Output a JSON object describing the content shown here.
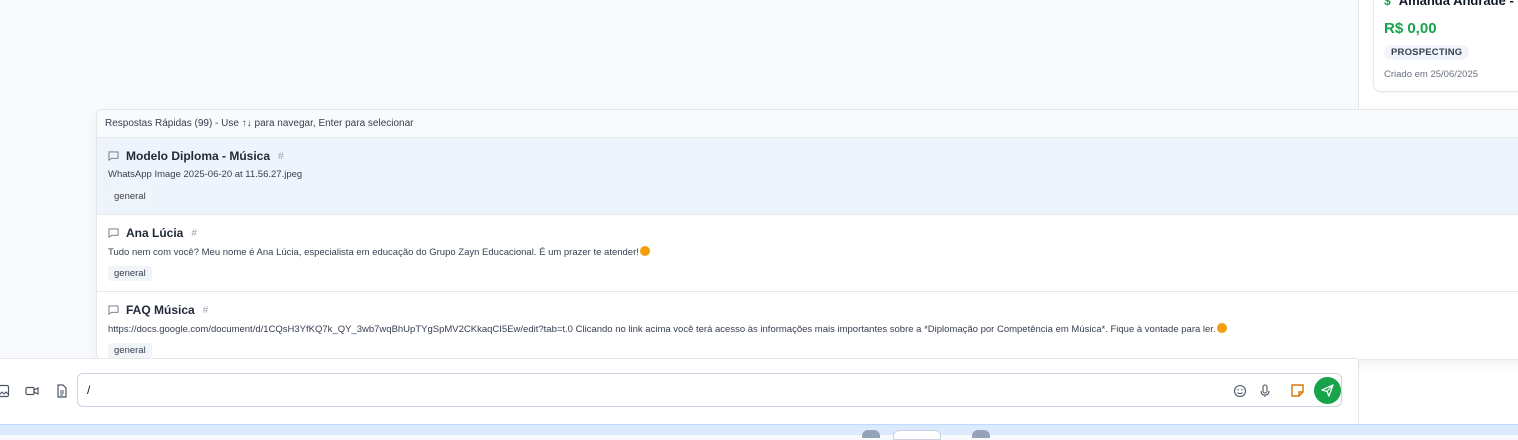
{
  "deal": {
    "title": "Amanda Andrade - ge",
    "value": "R$ 0,00",
    "stage": "PROSPECTING",
    "created": "Criado em 25/06/2025"
  },
  "quick_replies": {
    "header": "Respostas Rápidas (99) - Use ↑↓ para navegar, Enter para selecionar",
    "items": [
      {
        "title": "Modelo Diploma - Música",
        "content": "WhatsApp Image 2025-06-20 at 11.56.27.jpeg",
        "tag": "general"
      },
      {
        "title": "Ana Lúcia",
        "content": "Tudo nem com você? Meu nome é Ana Lúcia, especialista em educação do Grupo Zayn Educacional. É um prazer te atender!",
        "tag": "general"
      },
      {
        "title": "FAQ Música",
        "content": "https://docs.google.com/document/d/1CQsH3YfKQ7k_QY_3wb7wqBhUpTYgSpMV2CKkaqCI5Ew/edit?tab=t.0 Clicando no link acima você terá acesso às informações mais importantes sobre a *Diplomação por Competência em Música*. Fique à vontade para ler.",
        "tag": "general"
      }
    ]
  },
  "composer": {
    "value": "/"
  },
  "colors": {
    "accent_green": "#16a34a",
    "active_row": "#eef4fb"
  }
}
